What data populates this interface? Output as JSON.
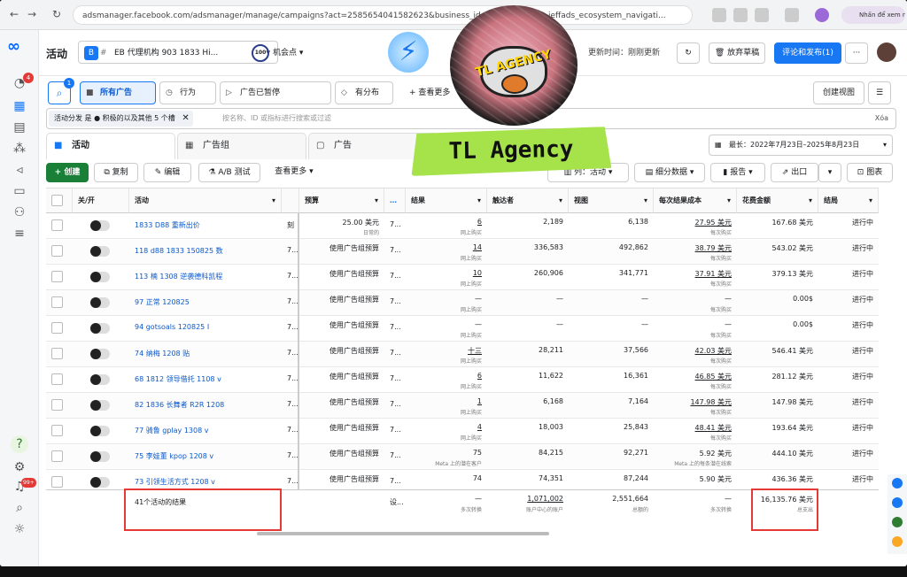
{
  "browser": {
    "url": "adsmanager.facebook.com/adsmanager/manage/campaigns?act=2585654041582623&business_id=6604305324... ieffads_ecosystem_navigati...",
    "profile": "Nhấn để xem nội dung"
  },
  "topbar": {
    "title": "活动",
    "account_badge": "B",
    "account_name": "EB 代理机构 903 1833 Hi...",
    "opportunity_score": "100",
    "opportunity_label": "机会点",
    "update_time": "更新时间：刚刚更新",
    "discard_label": "放弃草稿",
    "publish_label": "评论和发布(1)",
    "more_label": "···"
  },
  "toolbar": {
    "search_badge": "1",
    "pills": [
      "所有广告",
      "行为",
      "广告已暂停",
      "有分布"
    ],
    "see_more": "查看更多",
    "create_view": "创建视图"
  },
  "filter": {
    "chip": "活动分发 是 ● 积极的以及其他 5 个槽",
    "placeholder": "按名称、ID 或指标进行搜索或过滤",
    "clear": "Xóa"
  },
  "tabs": {
    "campaigns": "活动",
    "adsets": "广告组",
    "ads": "广告",
    "daterange": "最长：2022年7月23日–2025年8月23日"
  },
  "actions": {
    "create": "创建",
    "duplicate": "复制",
    "edit": "编辑",
    "ab_test": "A/B 测试",
    "view_more": "查看更多",
    "columns": "列：活动",
    "breakdown": "细分数据",
    "reports": "报告",
    "export": "出口",
    "charts": "图表"
  },
  "table": {
    "headers": [
      "关/开",
      "活动",
      "",
      "预算",
      "…",
      "结果",
      "触达者",
      "视图",
      "每次结果成本",
      "花费金额",
      "结局"
    ],
    "rows": [
      {
        "name": "1833 D88 重新出价",
        "col3": "刻",
        "budget": "25.00 美元",
        "budget_sub": "日常的",
        "d": "7...",
        "result": "6",
        "result_sub": "网上购买",
        "reach": "2,189",
        "views": "6,138",
        "cpr": "27.95 美元",
        "cpr_sub": "每次购买",
        "spend": "167.68 美元",
        "status": "进行中"
      },
      {
        "name": "118 d88 1833 150825 数",
        "col3": "7...",
        "budget": "使用广告组预算",
        "budget_sub": "",
        "d": "7...",
        "result": "14",
        "result_sub": "网上购买",
        "reach": "336,583",
        "views": "492,862",
        "cpr": "38.79 美元",
        "cpr_sub": "每次购买",
        "spend": "543.02 美元",
        "status": "进行中"
      },
      {
        "name": "113 楠 1308 逆袭德科凯程",
        "col3": "7...",
        "budget": "使用广告组预算",
        "budget_sub": "",
        "d": "7...",
        "result": "10",
        "result_sub": "网上购买",
        "reach": "260,906",
        "views": "341,771",
        "cpr": "37.91 美元",
        "cpr_sub": "每次购买",
        "spend": "379.13 美元",
        "status": "进行中"
      },
      {
        "name": "97 正常 120825",
        "col3": "7...",
        "budget": "使用广告组预算",
        "budget_sub": "",
        "d": "7...",
        "result": "—",
        "result_sub": "网上购买",
        "reach": "—",
        "views": "—",
        "cpr": "—",
        "cpr_sub": "每次购买",
        "spend": "0.00$",
        "status": "进行中"
      },
      {
        "name": "94 gotsoals 120825 I",
        "col3": "7...",
        "budget": "使用广告组预算",
        "budget_sub": "",
        "d": "7...",
        "result": "—",
        "result_sub": "网上购买",
        "reach": "—",
        "views": "—",
        "cpr": "—",
        "cpr_sub": "每次购买",
        "spend": "0.00$",
        "status": "进行中"
      },
      {
        "name": "74 纳梅 1208 贴",
        "col3": "7...",
        "budget": "使用广告组预算",
        "budget_sub": "",
        "d": "7...",
        "result": "十三",
        "result_sub": "网上购买",
        "reach": "28,211",
        "views": "37,566",
        "cpr": "42.03 美元",
        "cpr_sub": "每次购买",
        "spend": "546.41 美元",
        "status": "进行中"
      },
      {
        "name": "68 1812 领导借托 1108 v",
        "col3": "7...",
        "budget": "使用广告组预算",
        "budget_sub": "",
        "d": "7...",
        "result": "6",
        "result_sub": "网上购买",
        "reach": "11,622",
        "views": "16,361",
        "cpr": "46.85 美元",
        "cpr_sub": "每次购买",
        "spend": "281.12 美元",
        "status": "进行中"
      },
      {
        "name": "82 1836 长舞者 R2R 1208",
        "col3": "7...",
        "budget": "使用广告组预算",
        "budget_sub": "",
        "d": "7...",
        "result": "1",
        "result_sub": "网上购买",
        "reach": "6,168",
        "views": "7,164",
        "cpr": "147.98 美元",
        "cpr_sub": "每次购买",
        "spend": "147.98 美元",
        "status": "进行中"
      },
      {
        "name": "77 骑鲁 gplay 1308 v",
        "col3": "7...",
        "budget": "使用广告组预算",
        "budget_sub": "",
        "d": "7...",
        "result": "4",
        "result_sub": "网上购买",
        "reach": "18,003",
        "views": "25,843",
        "cpr": "48.41 美元",
        "cpr_sub": "每次购买",
        "spend": "193.64 美元",
        "status": "进行中"
      },
      {
        "name": "75 李娃董 kpop 1208 v",
        "col3": "7...",
        "budget": "使用广告组预算",
        "budget_sub": "",
        "d": "7...",
        "result": "75",
        "result_sub": "Meta 上的潜在客户",
        "reach": "84,215",
        "views": "92,271",
        "cpr": "5.92 美元",
        "cpr_sub": "Meta 上的每条潜在线索",
        "spend": "444.10 美元",
        "status": "进行中"
      },
      {
        "name": "73 引领生活方式 1208 v",
        "col3": "7...",
        "budget": "使用广告组预算",
        "budget_sub": "",
        "d": "7...",
        "result": "74",
        "result_sub": "",
        "reach": "74,351",
        "views": "87,244",
        "cpr": "5.90 美元",
        "cpr_sub": "",
        "spend": "436.36 美元",
        "status": "进行中"
      }
    ],
    "summary": {
      "label": "41个活动的结果",
      "col3": "设...",
      "result": "—",
      "result_sub": "多次转换",
      "reach": "1,071,002",
      "reach_sub": "账户中心的账户",
      "views": "2,551,664",
      "views_sub": "总额的",
      "cpr": "—",
      "cpr_sub": "多次转换",
      "spend": "16,135.76 美元",
      "spend_sub": "总支出"
    }
  },
  "overlay": {
    "brand": "TL Agency",
    "badge_text": "TL AGENCY"
  },
  "rail": {
    "notif_count": "4",
    "alerts_count": "99+",
    "help": "?"
  },
  "colors": {
    "accent": "#1877f2",
    "create_green": "#1a7f37",
    "highlight_red": "#e53935",
    "label_green": "#a6e34a"
  }
}
